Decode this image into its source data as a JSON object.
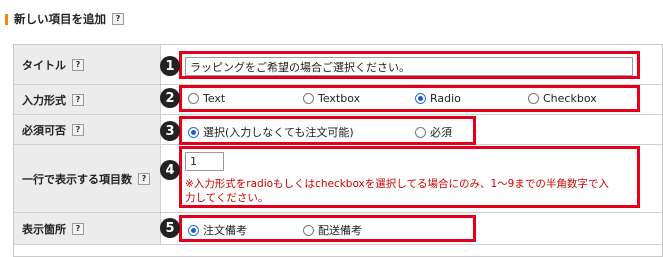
{
  "heading": {
    "title": "新しい項目を追加",
    "help": "?"
  },
  "rows": {
    "title": {
      "label": "タイトル",
      "help": "?",
      "marker": "1",
      "input_value": "ラッピングをご希望の場合ご選択ください。"
    },
    "input_type": {
      "label": "入力形式",
      "help": "?",
      "marker": "2",
      "options": [
        "Text",
        "Textbox",
        "Radio",
        "Checkbox"
      ],
      "selected": "Radio"
    },
    "required": {
      "label": "必須可否",
      "help": "?",
      "marker": "3",
      "options": [
        "選択(入力しなくても注文可能)",
        "必須"
      ],
      "selected": "選択(入力しなくても注文可能)"
    },
    "items_per_row": {
      "label": "一行で表示する項目数",
      "help": "?",
      "marker": "4",
      "input_value": "1",
      "note_line1": "※入力形式をradioもしくはcheckboxを選択してる場合にのみ、1〜9までの半角数字で入",
      "note_line2": "力してください。"
    },
    "display_location": {
      "label": "表示箇所",
      "help": "?",
      "marker": "5",
      "options": [
        "注文備考",
        "配送備考"
      ],
      "selected": "注文備考"
    }
  },
  "colors": {
    "accent": "#f08a00",
    "highlight": "#e4001b",
    "note": "#d00000",
    "radio_selected": "#1a5fd0"
  }
}
